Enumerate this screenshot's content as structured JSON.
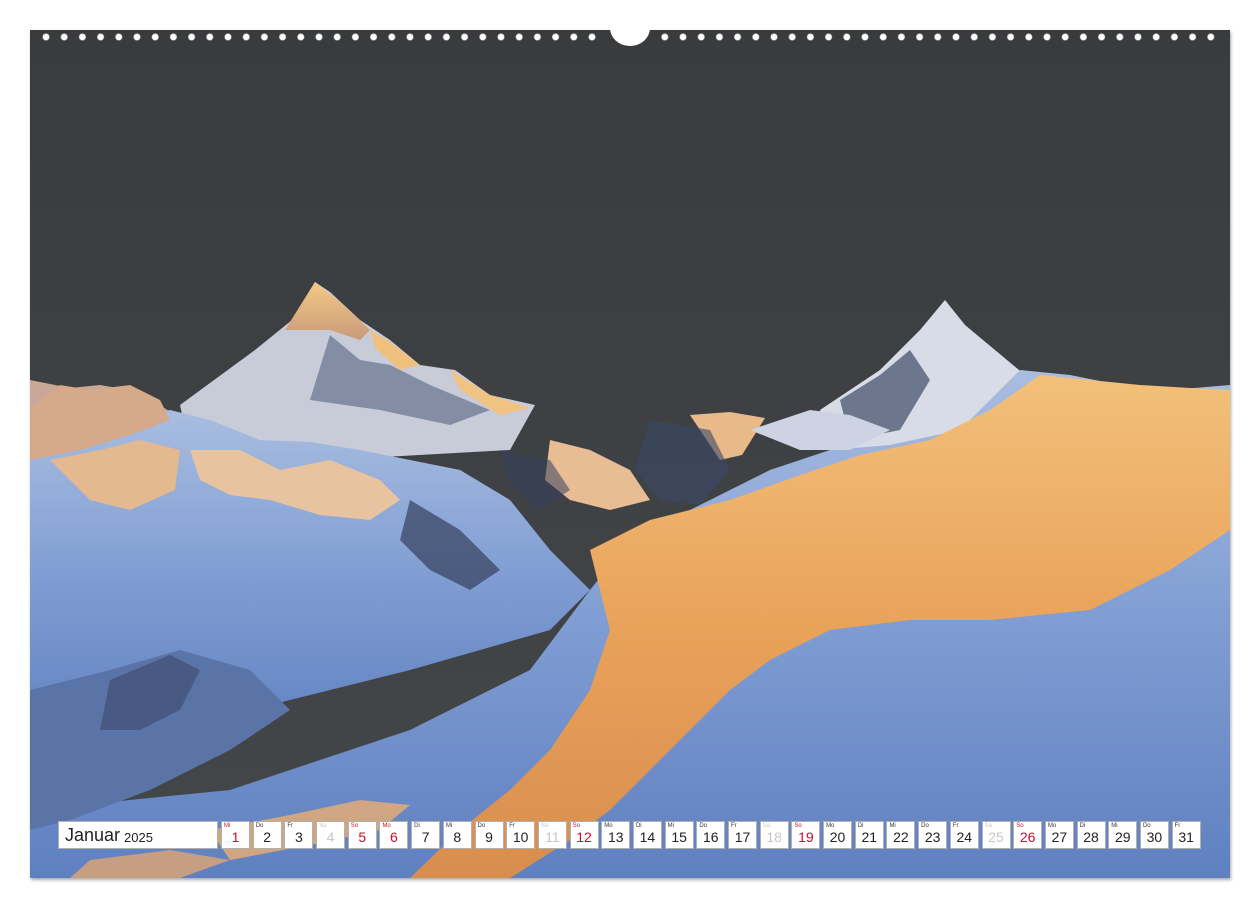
{
  "calendar": {
    "month": "Januar",
    "year": "2025",
    "colors": {
      "sunday_holiday": "#c8102e",
      "saturday": "#c7c7c7",
      "weekday": "#222222"
    },
    "days": [
      {
        "wd": "Mi",
        "num": "1",
        "kind": "red"
      },
      {
        "wd": "Do",
        "num": "2",
        "kind": "normal"
      },
      {
        "wd": "Fr",
        "num": "3",
        "kind": "normal"
      },
      {
        "wd": "Sa",
        "num": "4",
        "kind": "grey"
      },
      {
        "wd": "So",
        "num": "5",
        "kind": "red"
      },
      {
        "wd": "Mo",
        "num": "6",
        "kind": "red"
      },
      {
        "wd": "Di",
        "num": "7",
        "kind": "normal"
      },
      {
        "wd": "Mi",
        "num": "8",
        "kind": "normal"
      },
      {
        "wd": "Do",
        "num": "9",
        "kind": "normal"
      },
      {
        "wd": "Fr",
        "num": "10",
        "kind": "normal"
      },
      {
        "wd": "Sa",
        "num": "11",
        "kind": "grey"
      },
      {
        "wd": "So",
        "num": "12",
        "kind": "red"
      },
      {
        "wd": "Mo",
        "num": "13",
        "kind": "normal"
      },
      {
        "wd": "Di",
        "num": "14",
        "kind": "normal"
      },
      {
        "wd": "Mi",
        "num": "15",
        "kind": "normal"
      },
      {
        "wd": "Do",
        "num": "16",
        "kind": "normal"
      },
      {
        "wd": "Fr",
        "num": "17",
        "kind": "normal"
      },
      {
        "wd": "Sa",
        "num": "18",
        "kind": "grey"
      },
      {
        "wd": "So",
        "num": "19",
        "kind": "red"
      },
      {
        "wd": "Mo",
        "num": "20",
        "kind": "normal"
      },
      {
        "wd": "Di",
        "num": "21",
        "kind": "normal"
      },
      {
        "wd": "Mi",
        "num": "22",
        "kind": "normal"
      },
      {
        "wd": "Do",
        "num": "23",
        "kind": "normal"
      },
      {
        "wd": "Fr",
        "num": "24",
        "kind": "normal"
      },
      {
        "wd": "Sa",
        "num": "25",
        "kind": "grey"
      },
      {
        "wd": "So",
        "num": "26",
        "kind": "red"
      },
      {
        "wd": "Mo",
        "num": "27",
        "kind": "normal"
      },
      {
        "wd": "Di",
        "num": "28",
        "kind": "normal"
      },
      {
        "wd": "Mi",
        "num": "29",
        "kind": "normal"
      },
      {
        "wd": "Do",
        "num": "30",
        "kind": "normal"
      },
      {
        "wd": "Fr",
        "num": "31",
        "kind": "normal"
      }
    ]
  },
  "photo": {
    "subject": "mountain-sunrise-image",
    "sky_color": "#3c3f40",
    "alpenglow_color": "#e59a45",
    "snow_shadow_color": "#7d9bd0"
  }
}
